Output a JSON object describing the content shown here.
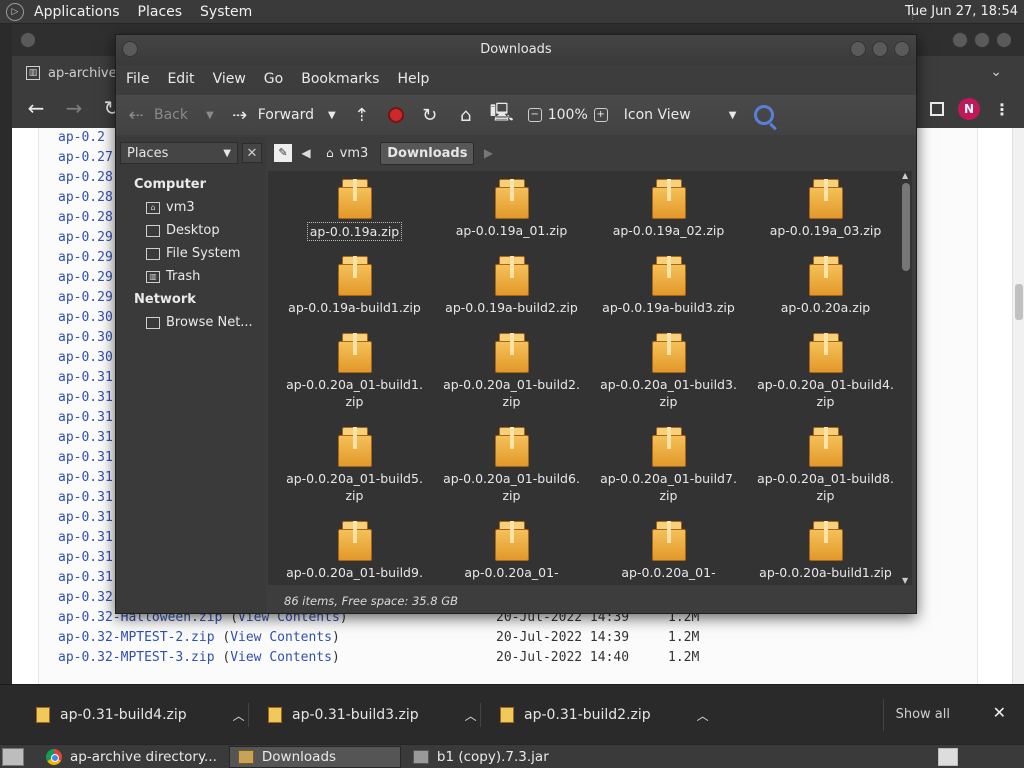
{
  "top_panel": {
    "menus": [
      "Applications",
      "Places",
      "System"
    ],
    "clock": "Tue Jun 27, 18:54"
  },
  "browser": {
    "tab_title": "ap-archive",
    "listing": {
      "partial_links": [
        "ap-0.2",
        "ap-0.27",
        "ap-0.28",
        "ap-0.28",
        "ap-0.28",
        "ap-0.29",
        "ap-0.29",
        "ap-0.29",
        "ap-0.29",
        "ap-0.30",
        "ap-0.30",
        "ap-0.30",
        "ap-0.31",
        "ap-0.31",
        "ap-0.31",
        "ap-0.31",
        "ap-0.31",
        "ap-0.31",
        "ap-0.31",
        "ap-0.31",
        "ap-0.31",
        "ap-0.31",
        "ap-0.31",
        "ap-0.32"
      ],
      "rows": [
        {
          "name": "ap-0.32-Halloween.zip",
          "view": "View Contents",
          "date": "20-Jul-2022 14:39",
          "size": "1.2M"
        },
        {
          "name": "ap-0.32-MPTEST-2.zip",
          "view": "View Contents",
          "date": "20-Jul-2022 14:39",
          "size": "1.2M"
        },
        {
          "name": "ap-0.32-MPTEST-3.zip",
          "view": "View Contents",
          "date": "20-Jul-2022 14:40",
          "size": "1.2M"
        }
      ]
    },
    "avatar_letter": "N"
  },
  "file_manager": {
    "title": "Downloads",
    "menu": [
      "File",
      "Edit",
      "View",
      "Go",
      "Bookmarks",
      "Help"
    ],
    "toolbar": {
      "back": "Back",
      "forward": "Forward",
      "zoom": "100%",
      "view_mode": "Icon View"
    },
    "sidebar": {
      "selector": "Places",
      "groups": [
        {
          "label": "Computer",
          "items": [
            "vm3",
            "Desktop",
            "File System",
            "Trash"
          ]
        },
        {
          "label": "Network",
          "items": [
            "Browse Net..."
          ]
        }
      ]
    },
    "path": [
      "vm3",
      "Downloads"
    ],
    "files": [
      "ap-0.0.19a.zip",
      "ap-0.0.19a_01.zip",
      "ap-0.0.19a_02.zip",
      "ap-0.0.19a_03.zip",
      "ap-0.0.19a-build1.zip",
      "ap-0.0.19a-build2.zip",
      "ap-0.0.19a-build3.zip",
      "ap-0.0.20a.zip",
      "ap-0.0.20a_01-build1.\nzip",
      "ap-0.0.20a_01-build2.\nzip",
      "ap-0.0.20a_01-build3.\nzip",
      "ap-0.0.20a_01-build4.\nzip",
      "ap-0.0.20a_01-build5.\nzip",
      "ap-0.0.20a_01-build6.\nzip",
      "ap-0.0.20a_01-build7.\nzip",
      "ap-0.0.20a_01-build8.\nzip",
      "ap-0.0.20a_01-build9.",
      "ap-0.0.20a_01-",
      "ap-0.0.20a_01-",
      "ap-0.0.20a-build1.zip"
    ],
    "status": "86 items, Free space: 35.8 GB"
  },
  "download_shelf": {
    "items": [
      "ap-0.31-build4.zip",
      "ap-0.31-build3.zip",
      "ap-0.31-build2.zip"
    ],
    "show_all": "Show all"
  },
  "taskbar": {
    "tasks": [
      "ap-archive directory...",
      "Downloads",
      "b1 (copy).7.3.jar"
    ]
  }
}
